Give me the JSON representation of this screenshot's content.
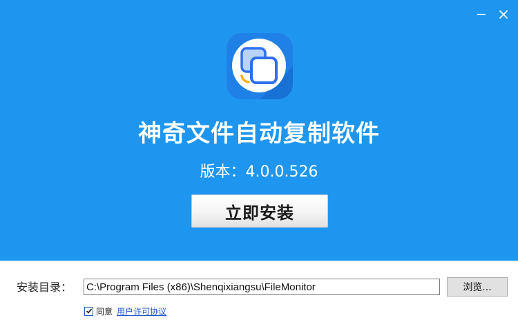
{
  "app": {
    "title": "神奇文件自动复制软件",
    "version_text": "版本：4.0.0.526"
  },
  "actions": {
    "install_label": "立即安装",
    "browse_label": "浏览..."
  },
  "install_dir": {
    "label": "安装目录：",
    "value": "C:\\Program Files (x86)\\Shenqixiangsu\\FileMonitor"
  },
  "agreement": {
    "checked": true,
    "label": "同意",
    "link_text": "用户许可协议"
  },
  "colors": {
    "banner": "#1e96f0",
    "logo_bg": "#1f80e6",
    "link": "#1a56c9"
  },
  "icons": {
    "window_minimize": "minimize-icon",
    "window_close": "close-icon",
    "app_logo": "copy-squares-icon"
  }
}
